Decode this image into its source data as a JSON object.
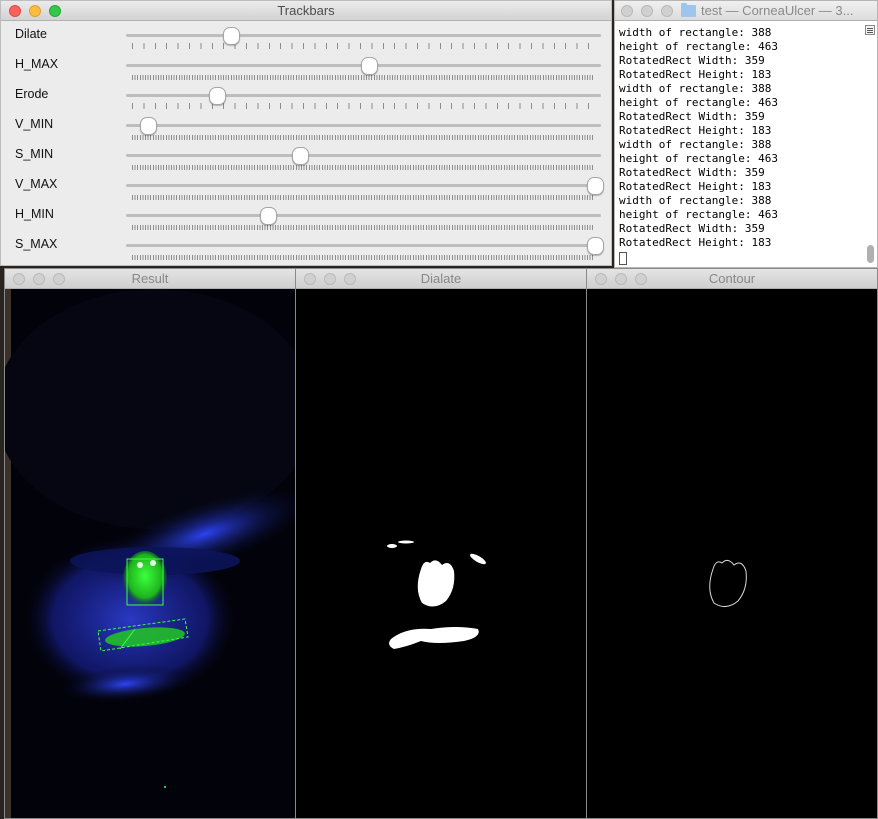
{
  "trackbars_window": {
    "title": "Trackbars",
    "sliders": [
      {
        "label": "Dilate",
        "value_fraction": 0.21,
        "ticks": "sparse"
      },
      {
        "label": "H_MAX",
        "value_fraction": 0.51,
        "ticks": "dense"
      },
      {
        "label": "Erode",
        "value_fraction": 0.18,
        "ticks": "sparse"
      },
      {
        "label": "V_MIN",
        "value_fraction": 0.03,
        "ticks": "dense"
      },
      {
        "label": "S_MIN",
        "value_fraction": 0.36,
        "ticks": "dense"
      },
      {
        "label": "V_MAX",
        "value_fraction": 1.0,
        "ticks": "dense"
      },
      {
        "label": "H_MIN",
        "value_fraction": 0.29,
        "ticks": "dense"
      },
      {
        "label": "S_MAX",
        "value_fraction": 1.0,
        "ticks": "dense"
      }
    ]
  },
  "terminal_window": {
    "title": "test — CorneaUlcer — 3...",
    "lines": [
      "width of rectangle: 388",
      "height of rectangle: 463",
      "RotatedRect Width: 359",
      "RotatedRect Height: 183",
      "width of rectangle: 388",
      "height of rectangle: 463",
      "RotatedRect Width: 359",
      "RotatedRect Height: 183",
      "width of rectangle: 388",
      "height of rectangle: 463",
      "RotatedRect Width: 359",
      "RotatedRect Height: 183",
      "width of rectangle: 388",
      "height of rectangle: 463",
      "RotatedRect Width: 359",
      "RotatedRect Height: 183"
    ]
  },
  "image_windows": {
    "result": {
      "title": "Result"
    },
    "dilate": {
      "title": "Dialate"
    },
    "contour": {
      "title": "Contour"
    }
  },
  "colors": {
    "close": "#fc605b",
    "minimize": "#fdbc40",
    "zoom": "#34c84a",
    "detection": "#3cff3c"
  }
}
